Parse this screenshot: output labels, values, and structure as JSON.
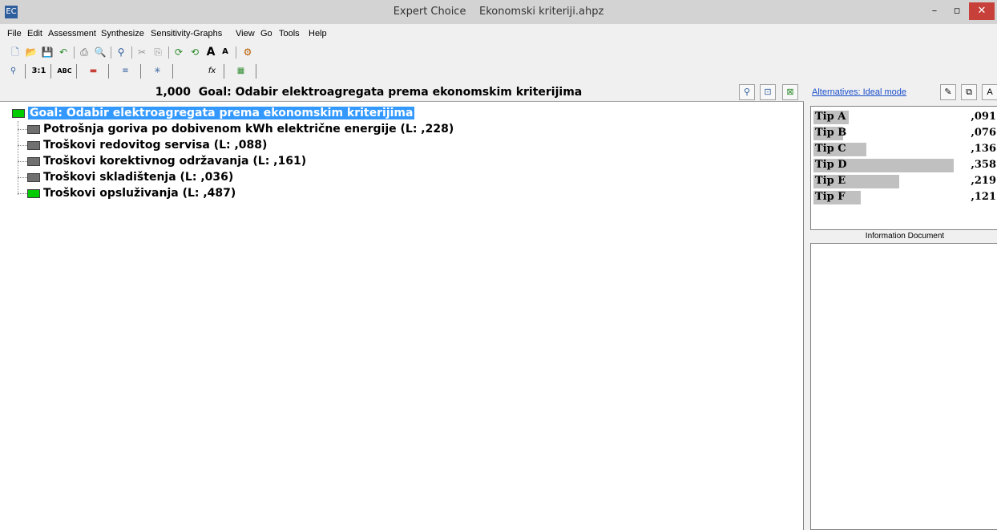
{
  "window": {
    "app_name": "Expert Choice",
    "file_name": "Ekonomski kriteriji.ahpz",
    "minimize": "–",
    "maximize": "▫",
    "close": "✕"
  },
  "menu": {
    "items": [
      "File",
      "Edit",
      "Assessment",
      "Synthesize",
      "Sensitivity-Graphs",
      "View",
      "Go",
      "Tools",
      "Help"
    ]
  },
  "toolbar": {
    "icons": [
      "new-icon",
      "open-icon",
      "save-icon",
      "undo-icon",
      "print-icon",
      "print-preview-icon",
      "hierarchy-icon",
      "cut-icon",
      "copy-icon",
      "refresh-icon",
      "refresh-all-icon",
      "font-larger-icon",
      "font-smaller-icon",
      "tools-icon"
    ]
  },
  "tabs": {
    "pairwise_numeric": "3:1",
    "verbal": "ABC",
    "formula": "fx"
  },
  "header": {
    "goal_priority": "1,000",
    "goal_title": "Goal: Odabir elektroagregata prema ekonomskim kriterijima"
  },
  "tree": {
    "goal": "Goal: Odabir elektroagregata prema ekonomskim kriterijima",
    "goal_color": "#00cc00",
    "criteria": [
      {
        "label": "Potrošnja goriva po dobivenom kWh električne energije (L: ,228)",
        "color": "#707070"
      },
      {
        "label": "Troškovi redovitog servisa (L: ,088)",
        "color": "#707070"
      },
      {
        "label": "Troškovi korektivnog održavanja (L: ,161)",
        "color": "#707070"
      },
      {
        "label": "Troškovi skladištenja (L: ,036)",
        "color": "#707070"
      },
      {
        "label": "Troškovi opsluživanja (L: ,487)",
        "color": "#00cc00"
      }
    ]
  },
  "side": {
    "alternatives_link": "Alternatives: Ideal mode",
    "info_header": "Information Document",
    "alternatives": [
      {
        "name": "Tip A",
        "value": ",091",
        "fraction": 0.091
      },
      {
        "name": "Tip B",
        "value": ",076",
        "fraction": 0.076
      },
      {
        "name": "Tip C",
        "value": ",136",
        "fraction": 0.136
      },
      {
        "name": "Tip D",
        "value": ",358",
        "fraction": 0.358
      },
      {
        "name": "Tip E",
        "value": ",219",
        "fraction": 0.219
      },
      {
        "name": "Tip F",
        "value": ",121",
        "fraction": 0.121
      }
    ]
  }
}
